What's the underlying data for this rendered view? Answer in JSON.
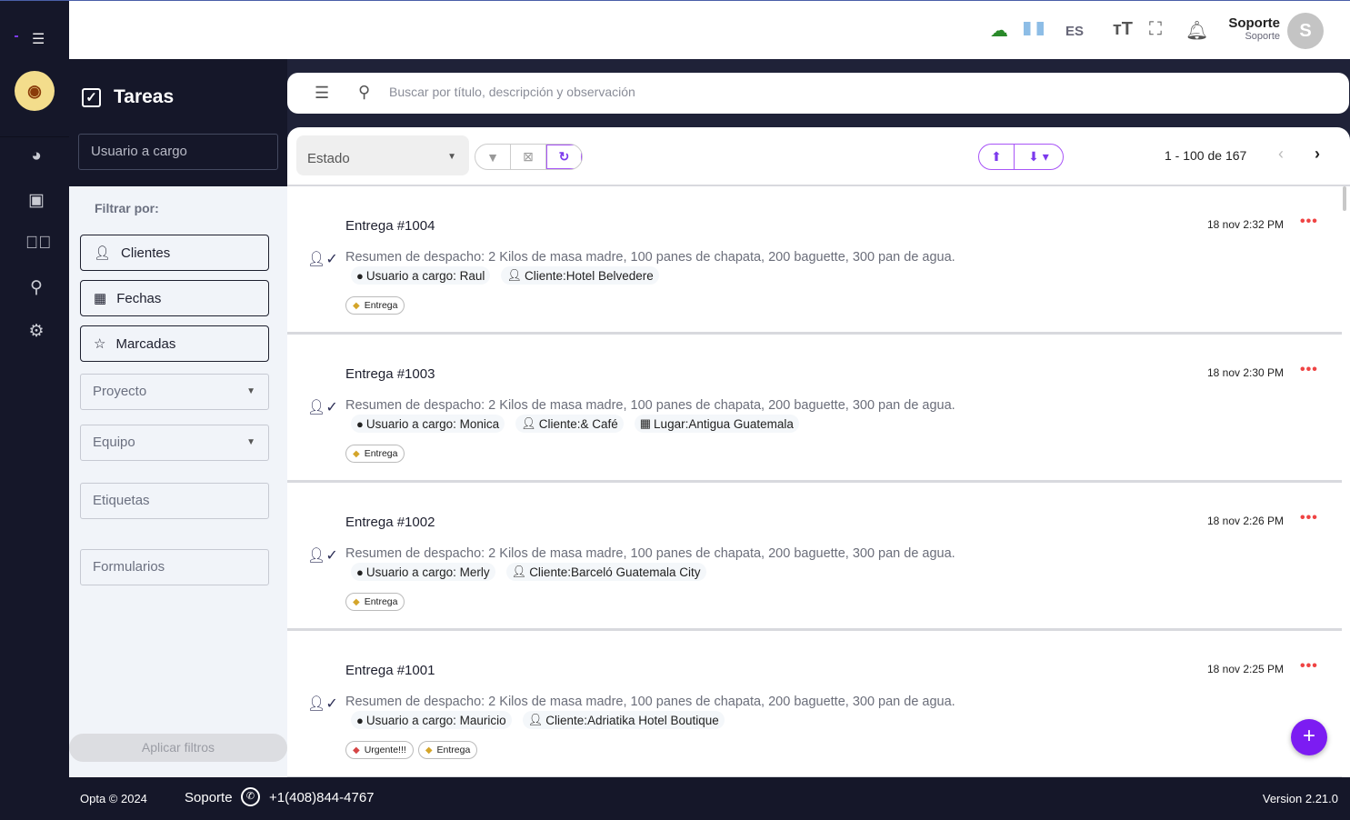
{
  "header": {
    "language": "ES",
    "user_name": "Soporte",
    "user_role": "Soporte",
    "avatar_initial": "S"
  },
  "panel": {
    "title": "Tareas",
    "user_filter_placeholder": "Usuario a cargo",
    "filter_label": "Filtrar por:",
    "filter_buttons": [
      "Clientes",
      "Fechas",
      "Marcadas"
    ],
    "selects": [
      "Proyecto",
      "Equipo"
    ],
    "inputs": [
      "Etiquetas",
      "Formularios"
    ],
    "apply_label": "Aplicar filtros"
  },
  "search": {
    "placeholder": "Buscar por título, descripción y observación"
  },
  "toolbar": {
    "estado_label": "Estado",
    "pagination": "1 - 100 de 167"
  },
  "tasks": [
    {
      "title": "Entrega #1004",
      "date": "18 nov 2:32 PM",
      "summary": "Resumen de despacho: 2 Kilos de masa madre, 100 panes de chapata, 200 baguette, 300 pan de agua.",
      "user": "Usuario a cargo: Raul",
      "client": "Cliente:Hotel Belvedere",
      "place": null,
      "tags": [
        {
          "label": "Entrega",
          "color": "#d4a52a"
        }
      ]
    },
    {
      "title": "Entrega #1003",
      "date": "18 nov 2:30 PM",
      "summary": "Resumen de despacho: 2 Kilos de masa madre, 100 panes de chapata, 200 baguette, 300 pan de agua.",
      "user": "Usuario a cargo: Monica",
      "client": "Cliente:& Café",
      "place": "Lugar:Antigua Guatemala",
      "tags": [
        {
          "label": "Entrega",
          "color": "#d4a52a"
        }
      ]
    },
    {
      "title": "Entrega #1002",
      "date": "18 nov 2:26 PM",
      "summary": "Resumen de despacho: 2 Kilos de masa madre, 100 panes de chapata, 200 baguette, 300 pan de agua.",
      "user": "Usuario a cargo: Merly",
      "client": "Cliente:Barceló Guatemala City",
      "place": null,
      "tags": [
        {
          "label": "Entrega",
          "color": "#d4a52a"
        }
      ]
    },
    {
      "title": "Entrega #1001",
      "date": "18 nov 2:25 PM",
      "summary": "Resumen de despacho: 2 Kilos de masa madre, 100 panes de chapata, 200 baguette, 300 pan de agua.",
      "user": "Usuario a cargo: Mauricio",
      "client": "Cliente:Adriatika Hotel Boutique",
      "place": null,
      "tags": [
        {
          "label": "Urgente!!!",
          "color": "#d64545"
        },
        {
          "label": "Entrega",
          "color": "#d4a52a"
        }
      ]
    }
  ],
  "footer": {
    "copyright": "Opta © 2024",
    "support": "Soporte",
    "phone": "+1(408)844-4767",
    "version": "Version 2.21.0"
  },
  "colors": {
    "accent": "#7c1cf2",
    "dark": "#151729"
  }
}
